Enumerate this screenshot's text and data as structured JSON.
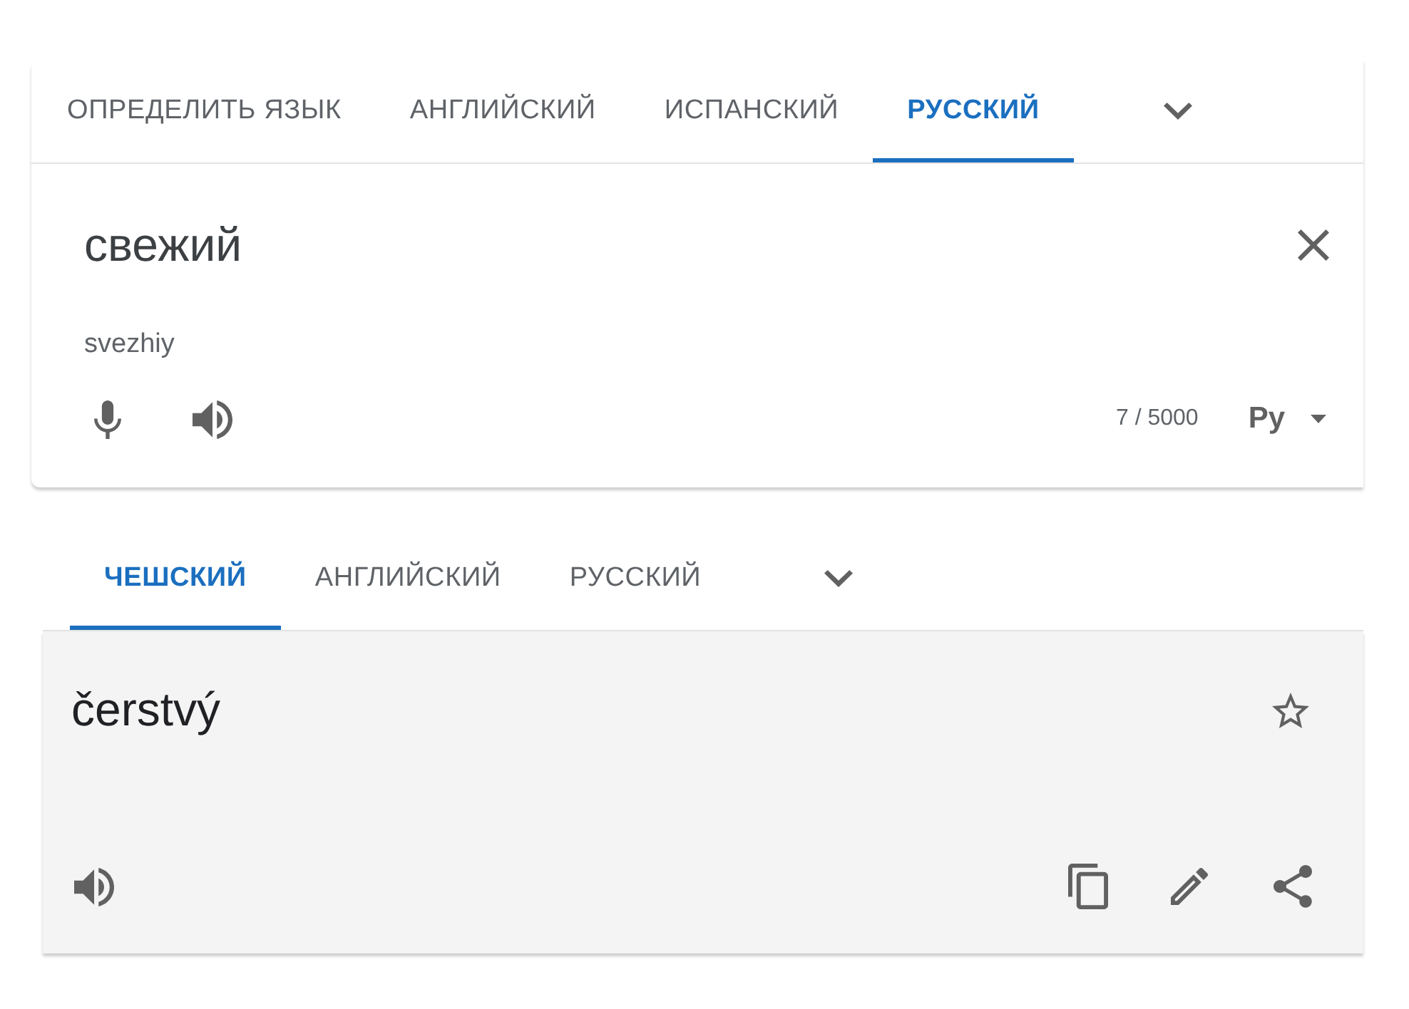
{
  "source": {
    "tabs": [
      {
        "label": "ОПРЕДЕЛИТЬ ЯЗЫК",
        "selected": false
      },
      {
        "label": "АНГЛИЙСКИЙ",
        "selected": false
      },
      {
        "label": "ИСПАНСКИЙ",
        "selected": false
      },
      {
        "label": "РУССКИЙ",
        "selected": true
      }
    ],
    "text": "свежий",
    "transliteration": "svezhiy",
    "char_count": "7 / 5000",
    "input_tool": "Ру"
  },
  "target": {
    "tabs": [
      {
        "label": "ЧЕШСКИЙ",
        "selected": true
      },
      {
        "label": "АНГЛИЙСКИЙ",
        "selected": false
      },
      {
        "label": "РУССКИЙ",
        "selected": false
      }
    ],
    "text": "čerstvý"
  }
}
